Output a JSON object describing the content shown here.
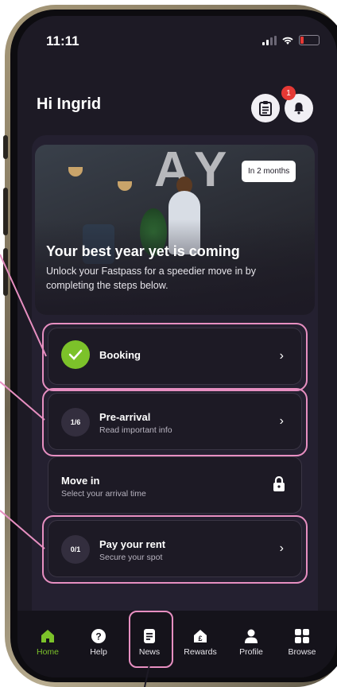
{
  "status_bar": {
    "time": "11:11"
  },
  "greeting": "Hi Ingrid",
  "notifications": {
    "count": "1"
  },
  "hero": {
    "chip": "In 2 months",
    "title": "Your best year yet is coming",
    "subtitle": "Unlock your Fastpass for a speedier move in by completing the steps below."
  },
  "steps": [
    {
      "label": "Booking",
      "sublabel": "",
      "progress": "",
      "state": "complete"
    },
    {
      "label": "Pre-arrival",
      "sublabel": "Read important info",
      "progress": "1/6",
      "state": "open"
    },
    {
      "label": "Move in",
      "sublabel": "Select your arrival time",
      "progress": "",
      "state": "locked"
    },
    {
      "label": "Pay your rent",
      "sublabel": "Secure your spot",
      "progress": "0/1",
      "state": "open"
    }
  ],
  "tabs": [
    {
      "label": "Home",
      "icon": "home-icon",
      "active": true
    },
    {
      "label": "Help",
      "icon": "help-icon",
      "active": false
    },
    {
      "label": "News",
      "icon": "news-icon",
      "active": false
    },
    {
      "label": "Rewards",
      "icon": "rewards-icon",
      "active": false
    },
    {
      "label": "Profile",
      "icon": "profile-icon",
      "active": false
    },
    {
      "label": "Browse",
      "icon": "browse-icon",
      "active": false
    }
  ],
  "colors": {
    "accent": "#7cc22a",
    "highlight": "#e78fc1",
    "badge": "#e53935",
    "background": "#1d1a25"
  }
}
